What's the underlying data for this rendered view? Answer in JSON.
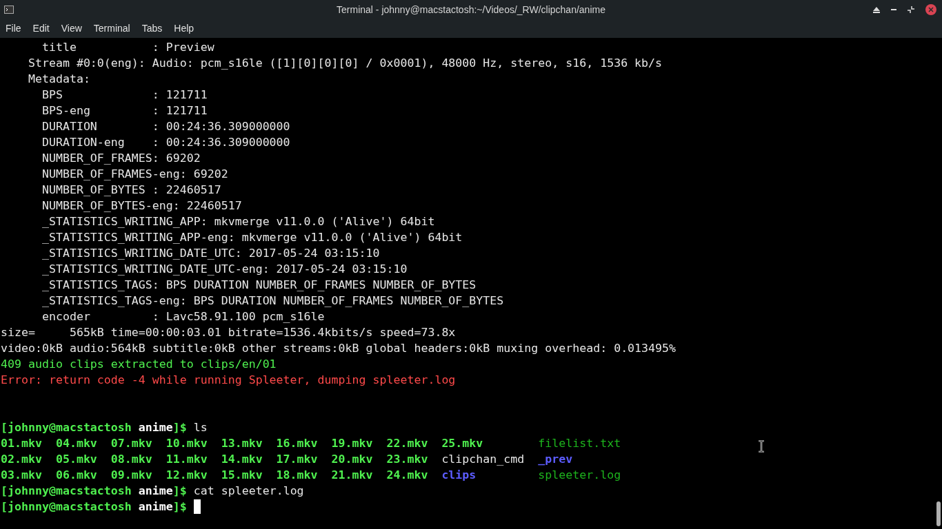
{
  "window": {
    "title": "Terminal - johnny@macstactosh:~/Videos/_RW/clipchan/anime"
  },
  "menu": [
    "File",
    "Edit",
    "View",
    "Terminal",
    "Tabs",
    "Help"
  ],
  "output": [
    [
      {
        "kind": "plain",
        "text": "      title           : Preview"
      }
    ],
    [
      {
        "kind": "plain",
        "text": "    Stream #0:0(eng): Audio: pcm_s16le ([1][0][0][0] / 0x0001), 48000 Hz, stereo, s16, 1536 kb/s"
      }
    ],
    [
      {
        "kind": "plain",
        "text": "    Metadata:"
      }
    ],
    [
      {
        "kind": "plain",
        "text": "      BPS             : 121711"
      }
    ],
    [
      {
        "kind": "plain",
        "text": "      BPS-eng         : 121711"
      }
    ],
    [
      {
        "kind": "plain",
        "text": "      DURATION        : 00:24:36.309000000"
      }
    ],
    [
      {
        "kind": "plain",
        "text": "      DURATION-eng    : 00:24:36.309000000"
      }
    ],
    [
      {
        "kind": "plain",
        "text": "      NUMBER_OF_FRAMES: 69202"
      }
    ],
    [
      {
        "kind": "plain",
        "text": "      NUMBER_OF_FRAMES-eng: 69202"
      }
    ],
    [
      {
        "kind": "plain",
        "text": "      NUMBER_OF_BYTES : 22460517"
      }
    ],
    [
      {
        "kind": "plain",
        "text": "      NUMBER_OF_BYTES-eng: 22460517"
      }
    ],
    [
      {
        "kind": "plain",
        "text": "      _STATISTICS_WRITING_APP: mkvmerge v11.0.0 ('Alive') 64bit"
      }
    ],
    [
      {
        "kind": "plain",
        "text": "      _STATISTICS_WRITING_APP-eng: mkvmerge v11.0.0 ('Alive') 64bit"
      }
    ],
    [
      {
        "kind": "plain",
        "text": "      _STATISTICS_WRITING_DATE_UTC: 2017-05-24 03:15:10"
      }
    ],
    [
      {
        "kind": "plain",
        "text": "      _STATISTICS_WRITING_DATE_UTC-eng: 2017-05-24 03:15:10"
      }
    ],
    [
      {
        "kind": "plain",
        "text": "      _STATISTICS_TAGS: BPS DURATION NUMBER_OF_FRAMES NUMBER_OF_BYTES"
      }
    ],
    [
      {
        "kind": "plain",
        "text": "      _STATISTICS_TAGS-eng: BPS DURATION NUMBER_OF_FRAMES NUMBER_OF_BYTES"
      }
    ],
    [
      {
        "kind": "plain",
        "text": "      encoder         : Lavc58.91.100 pcm_s16le"
      }
    ],
    [
      {
        "kind": "plain",
        "text": "size=     565kB time=00:00:03.01 bitrate=1536.4kbits/s speed=73.8x"
      }
    ],
    [
      {
        "kind": "plain",
        "text": "video:0kB audio:564kB subtitle:0kB other streams:0kB global headers:0kB muxing overhead: 0.013495%"
      }
    ],
    [
      {
        "kind": "success",
        "text": "409 audio clips extracted to clips/en/01"
      }
    ],
    [
      {
        "kind": "error",
        "text": "Error: return code -4 while running Spleeter, dumping spleeter.log"
      }
    ]
  ],
  "prompt_1": {
    "user": "[johnny@macstactosh",
    "dir": "anime",
    "end": "]$",
    "command": "ls"
  },
  "listing": [
    [
      {
        "kind": "exe",
        "name": "01.mkv"
      },
      {
        "kind": "exe",
        "name": "04.mkv"
      },
      {
        "kind": "exe",
        "name": "07.mkv"
      },
      {
        "kind": "exe",
        "name": "10.mkv"
      },
      {
        "kind": "exe",
        "name": "13.mkv"
      },
      {
        "kind": "exe",
        "name": "16.mkv"
      },
      {
        "kind": "exe",
        "name": "19.mkv"
      },
      {
        "kind": "exe",
        "name": "22.mkv"
      },
      {
        "kind": "exe",
        "name": "25.mkv"
      },
      {
        "kind": "file",
        "name": "filelist.txt"
      }
    ],
    [
      {
        "kind": "exe",
        "name": "02.mkv"
      },
      {
        "kind": "exe",
        "name": "05.mkv"
      },
      {
        "kind": "exe",
        "name": "08.mkv"
      },
      {
        "kind": "exe",
        "name": "11.mkv"
      },
      {
        "kind": "exe",
        "name": "14.mkv"
      },
      {
        "kind": "exe",
        "name": "17.mkv"
      },
      {
        "kind": "exe",
        "name": "20.mkv"
      },
      {
        "kind": "exe",
        "name": "23.mkv"
      },
      {
        "kind": "plain",
        "name": "clipchan_cmd"
      },
      {
        "kind": "dir",
        "name": "_prev"
      }
    ],
    [
      {
        "kind": "exe",
        "name": "03.mkv"
      },
      {
        "kind": "exe",
        "name": "06.mkv"
      },
      {
        "kind": "exe",
        "name": "09.mkv"
      },
      {
        "kind": "exe",
        "name": "12.mkv"
      },
      {
        "kind": "exe",
        "name": "15.mkv"
      },
      {
        "kind": "exe",
        "name": "18.mkv"
      },
      {
        "kind": "exe",
        "name": "21.mkv"
      },
      {
        "kind": "exe",
        "name": "24.mkv"
      },
      {
        "kind": "dir",
        "name": "clips"
      },
      {
        "kind": "file",
        "name": "spleeter.log"
      }
    ]
  ],
  "prompt_2": {
    "user": "[johnny@macstactosh",
    "dir": "anime",
    "end": "]$",
    "command": "cat spleeter.log"
  },
  "prompt_3": {
    "user": "[johnny@macstactosh",
    "dir": "anime",
    "end": "]$"
  }
}
